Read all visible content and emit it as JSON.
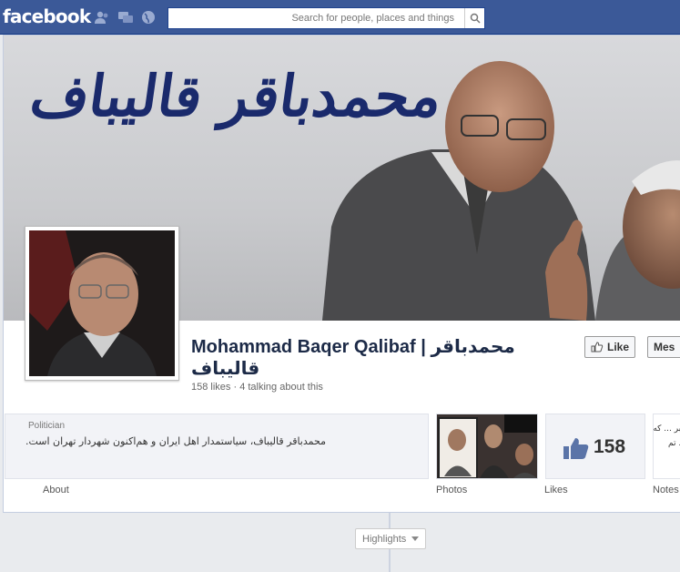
{
  "topbar": {
    "logo": "facebook",
    "search_placeholder": "Search for people, places and things"
  },
  "cover": {
    "title": "محمدباقر قالیباف"
  },
  "page": {
    "name": "Mohammad Baqer Qalibaf | محمدباقر قالیباف",
    "stats": "158 likes · 4 talking about this",
    "category": "Politician",
    "description": "محمدباقر قالیباف، سیاستمدار اهل ایران و هم‌اکنون شهردار تهران است.",
    "notes_preview": "خبر ... که ... تم"
  },
  "actions": {
    "like_label": "Like",
    "message_label": "Mes"
  },
  "tabs": {
    "about": "About",
    "photos": "Photos",
    "likes": "Likes",
    "notes": "Notes"
  },
  "likes_tile": {
    "count": "158"
  },
  "timeline": {
    "highlights_label": "Highlights"
  },
  "colors": {
    "brand": "#3b5998",
    "name_text": "#1c2a47",
    "cover_title": "#1a2a6c"
  }
}
